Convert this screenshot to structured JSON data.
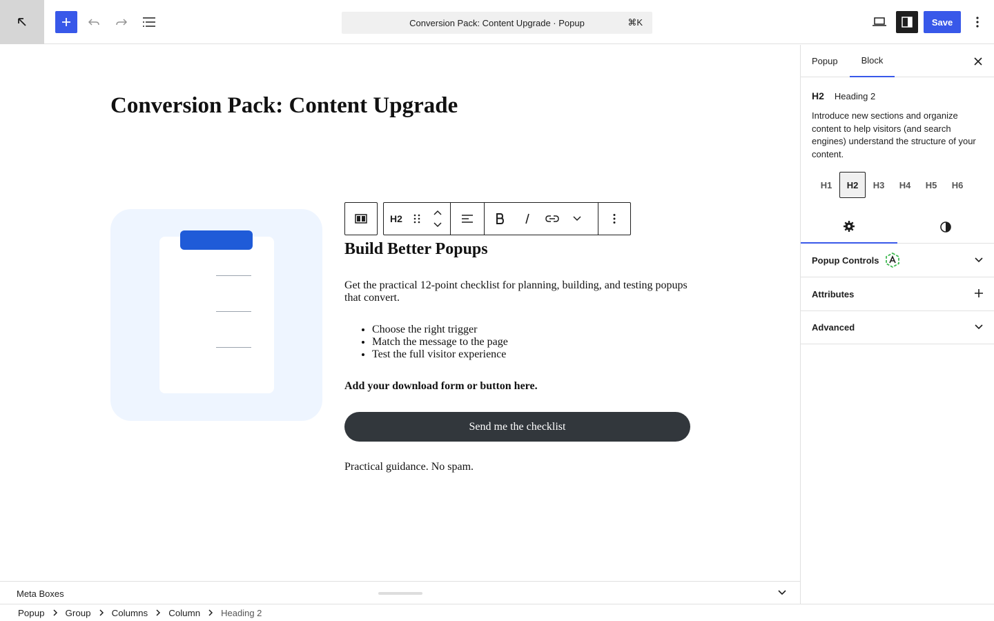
{
  "toolbar": {
    "command_title": "Conversion Pack: Content Upgrade · Popup",
    "command_shortcut": "⌘K",
    "save_label": "Save"
  },
  "canvas": {
    "page_title": "Conversion Pack: Content Upgrade",
    "block_toolbar": {
      "heading_level": "H2"
    },
    "heading": "Build Better Popups",
    "description": "Get the practical 12-point checklist for planning, building, and testing popups that convert.",
    "bullets": [
      "Choose the right trigger",
      "Match the message to the page",
      "Test the full visitor experience"
    ],
    "cta_text": "Add your download form or button here.",
    "button_label": "Send me the checklist",
    "footnote": "Practical guidance. No spam."
  },
  "metabox": {
    "label": "Meta Boxes"
  },
  "breadcrumb": [
    "Popup",
    "Group",
    "Columns",
    "Column",
    "Heading 2"
  ],
  "sidebar": {
    "tabs": [
      "Popup",
      "Block"
    ],
    "block_card": {
      "tag": "H2",
      "title": "Heading 2",
      "description": "Introduce new sections and organize content to help visitors (and search engines) understand the structure of your content."
    },
    "levels": [
      "H1",
      "H2",
      "H3",
      "H4",
      "H5",
      "H6"
    ],
    "active_level": "H2",
    "panels": [
      "Popup Controls",
      "Attributes",
      "Advanced"
    ]
  },
  "colors": {
    "accent": "#3858e9",
    "button_dark": "#32373c",
    "image_bg": "#eef5ff",
    "clip_blue": "#1f5bd8",
    "badge_green": "#3fb950"
  }
}
